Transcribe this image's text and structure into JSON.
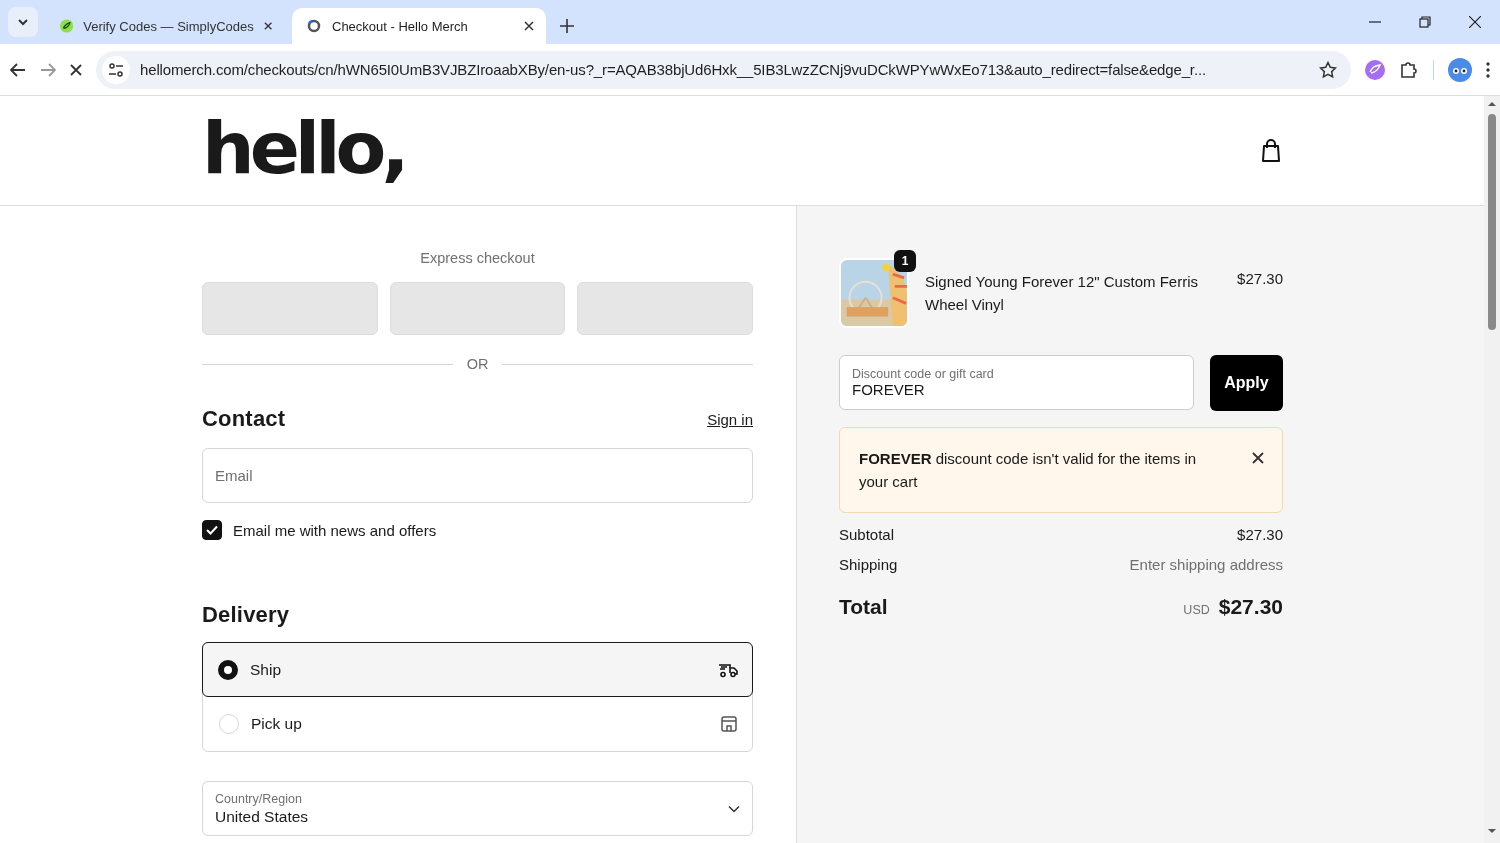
{
  "browser": {
    "tabs": [
      {
        "title": "Verify Codes — SimplyCodes",
        "selected": false,
        "kind": "site"
      },
      {
        "title": "Checkout - Hello Merch",
        "selected": true,
        "kind": "loading"
      }
    ],
    "url": "hellomerch.com/checkouts/cn/hWN65I0UmB3VJBZIroaabXBy/en-us?_r=AQAB38bjUd6Hxk__5IB3LwzZCNj9vuDCkWPYwWxEo713&auto_redirect=false&edge_r..."
  },
  "header": {
    "logo": "hello,"
  },
  "checkout": {
    "express_label": "Express checkout",
    "express_buttons": [
      {
        "kind": "payment"
      },
      {
        "kind": "payment"
      },
      {
        "kind": "payment"
      }
    ],
    "divider": "OR",
    "contact": {
      "heading": "Contact",
      "sign_in": "Sign in",
      "email_placeholder": "Email",
      "newsletter": {
        "label": "Email me with news and offers",
        "checked": true
      }
    },
    "delivery": {
      "heading": "Delivery",
      "options": [
        {
          "label": "Ship",
          "selected": true,
          "kind": "truck"
        },
        {
          "label": "Pick up",
          "selected": false,
          "kind": "store"
        }
      ],
      "country": {
        "label": "Country/Region",
        "value": "United States"
      }
    }
  },
  "summary": {
    "items": [
      {
        "name": "Signed Young Forever 12\" Custom Ferris Wheel Vinyl",
        "price": "$27.30",
        "quantity": "1",
        "kind": "picture"
      }
    ],
    "discount": {
      "label": "Discount code or gift card",
      "value": "FOREVER",
      "button": "Apply"
    },
    "error": "**FOREVER** discount code isn't valid for the items in your cart",
    "lines": [
      {
        "label": "Subtotal",
        "value": "$27.30",
        "kind": "amount"
      },
      {
        "label": "Shipping",
        "value": "Enter shipping address",
        "kind": "note"
      }
    ],
    "total": {
      "label": "Total",
      "currency": "USD",
      "value": "$27.30"
    }
  }
}
